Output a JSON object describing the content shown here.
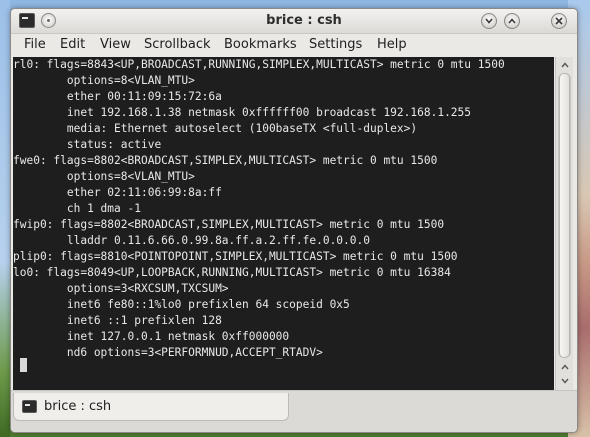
{
  "window": {
    "title": "brice : csh"
  },
  "menubar": {
    "items": [
      "File",
      "Edit",
      "View",
      "Scrollback",
      "Bookmarks",
      "Settings",
      "Help"
    ]
  },
  "terminal": {
    "lines": [
      "rl0: flags=8843<UP,BROADCAST,RUNNING,SIMPLEX,MULTICAST> metric 0 mtu 1500",
      "        options=8<VLAN_MTU>",
      "        ether 00:11:09:15:72:6a",
      "        inet 192.168.1.38 netmask 0xffffff00 broadcast 192.168.1.255",
      "        media: Ethernet autoselect (100baseTX <full-duplex>)",
      "        status: active",
      "fwe0: flags=8802<BROADCAST,SIMPLEX,MULTICAST> metric 0 mtu 1500",
      "        options=8<VLAN_MTU>",
      "        ether 02:11:06:99:8a:ff",
      "        ch 1 dma -1",
      "fwip0: flags=8802<BROADCAST,SIMPLEX,MULTICAST> metric 0 mtu 1500",
      "        lladdr 0.11.6.66.0.99.8a.ff.a.2.ff.fe.0.0.0.0",
      "plip0: flags=8810<POINTOPOINT,SIMPLEX,MULTICAST> metric 0 mtu 1500",
      "lo0: flags=8049<UP,LOOPBACK,RUNNING,MULTICAST> metric 0 mtu 16384",
      "        options=3<RXCSUM,TXCSUM>",
      "        inet6 fe80::1%lo0 prefixlen 64 scopeid 0x5",
      "        inet6 ::1 prefixlen 128",
      "        inet 127.0.0.1 netmask 0xff000000",
      "        nd6 options=3<PERFORMNUD,ACCEPT_RTADV>"
    ]
  },
  "tabs": [
    {
      "label": "brice : csh"
    }
  ]
}
